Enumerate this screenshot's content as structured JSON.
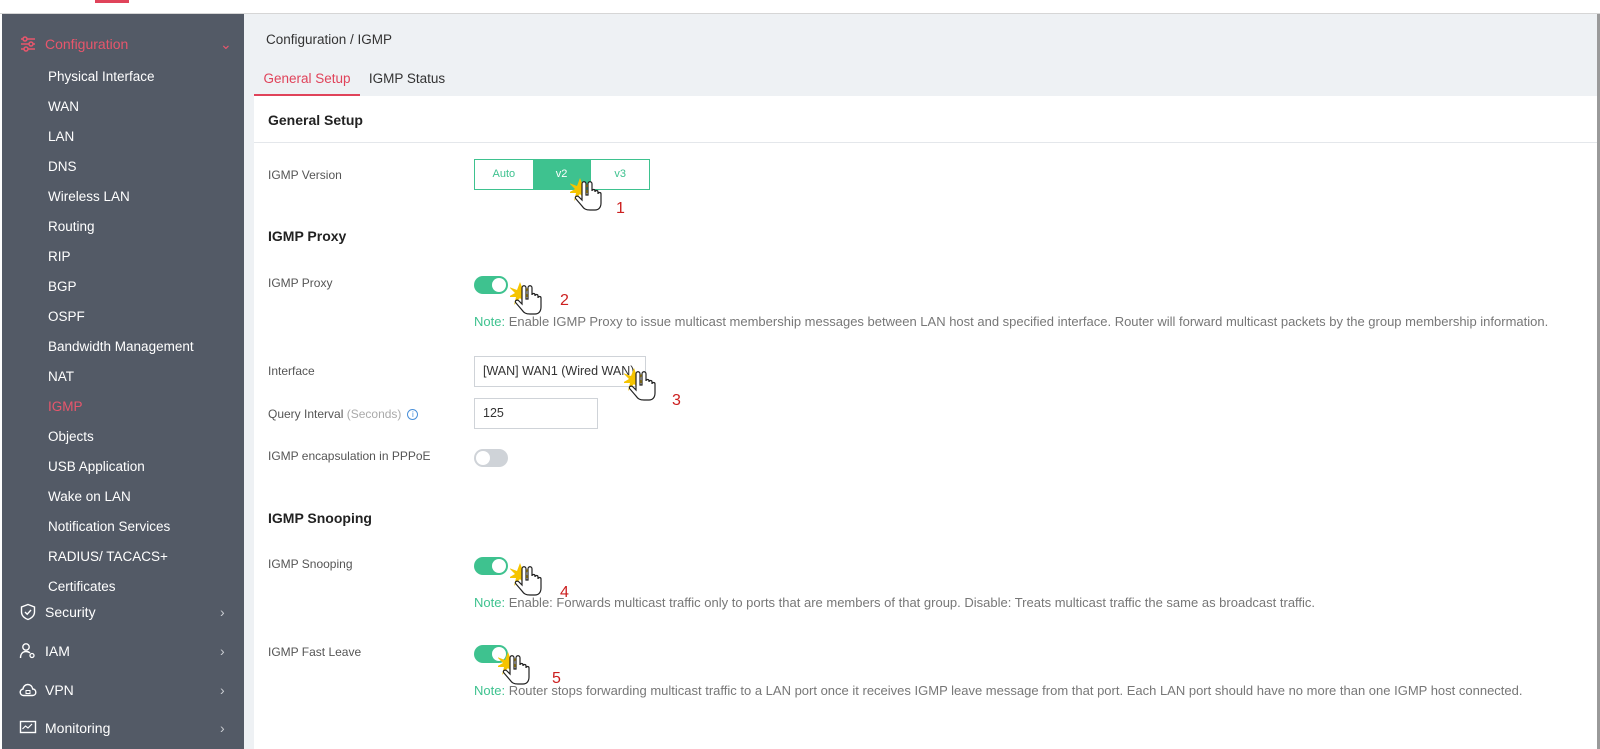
{
  "sidebar": {
    "configuration": "Configuration",
    "items": [
      {
        "label": "Physical Interface",
        "active": false
      },
      {
        "label": "WAN",
        "active": false
      },
      {
        "label": "LAN",
        "active": false
      },
      {
        "label": "DNS",
        "active": false
      },
      {
        "label": "Wireless LAN",
        "active": false
      },
      {
        "label": "Routing",
        "active": false
      },
      {
        "label": "RIP",
        "active": false
      },
      {
        "label": "BGP",
        "active": false
      },
      {
        "label": "OSPF",
        "active": false
      },
      {
        "label": "Bandwidth Management",
        "active": false
      },
      {
        "label": "NAT",
        "active": false
      },
      {
        "label": "IGMP",
        "active": true
      },
      {
        "label": "Objects",
        "active": false
      },
      {
        "label": "USB Application",
        "active": false
      },
      {
        "label": "Wake on LAN",
        "active": false
      },
      {
        "label": "Notification Services",
        "active": false
      },
      {
        "label": "RADIUS/ TACACS+",
        "active": false
      },
      {
        "label": "Certificates",
        "active": false
      }
    ],
    "security": "Security",
    "iam": "IAM",
    "vpn": "VPN",
    "monitoring": "Monitoring"
  },
  "breadcrumb": "Configuration / IGMP",
  "tabs": {
    "general": "General Setup",
    "status": "IGMP Status"
  },
  "panel": {
    "title": "General Setup",
    "igmp_version_label": "IGMP Version",
    "version_options": [
      "Auto",
      "v2",
      "v3"
    ],
    "version_selected": "v2",
    "proxy_section": "IGMP Proxy",
    "proxy_label": "IGMP Proxy",
    "proxy_enabled": true,
    "note_key": "Note:",
    "proxy_note": " Enable IGMP Proxy to issue multicast membership messages between LAN host and specified interface. Router will forward multicast packets by the group membership information.",
    "interface_label": "Interface",
    "interface_value": "[WAN] WAN1 (Wired WAN)",
    "query_label": "Query Interval",
    "query_unit": "(Seconds)",
    "query_value": "125",
    "pppoe_label": "IGMP encapsulation in PPPoE",
    "pppoe_enabled": false,
    "snooping_section": "IGMP Snooping",
    "snooping_label": "IGMP Snooping",
    "snooping_enabled": true,
    "snooping_note": " Enable: Forwards multicast traffic only to ports that are members of that group. Disable: Treats multicast traffic the same as broadcast traffic.",
    "fastleave_label": "IGMP Fast Leave",
    "fastleave_enabled": true,
    "fastleave_note": " Router stops forwarding multicast traffic to a LAN port once it receives IGMP leave message from that port. Each LAN port should have no more than one IGMP host connected."
  },
  "steps": [
    "1",
    "2",
    "3",
    "4",
    "5"
  ],
  "colors": {
    "accent_red": "#e0435a",
    "accent_green": "#3ec28f",
    "sidebar_bg": "#535a66"
  }
}
